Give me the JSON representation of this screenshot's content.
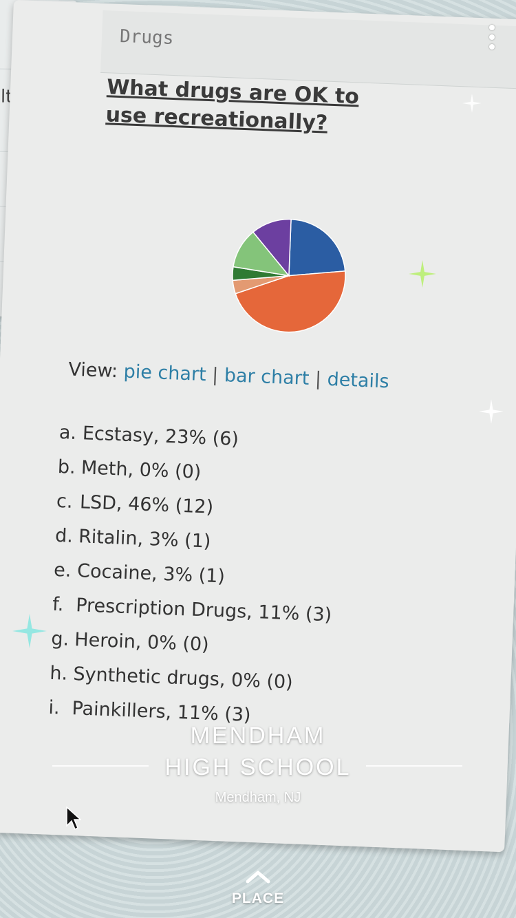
{
  "left_page": {
    "fragment": "lthy"
  },
  "page": {
    "header_label": "Drugs",
    "question": "What drugs are OK to use recreationally?",
    "view": {
      "prefix": "View:",
      "links": [
        "pie chart",
        "bar chart",
        "details"
      ],
      "separator": "|"
    },
    "answers": [
      {
        "letter": "a.",
        "text": "Ecstasy, 23% (6)"
      },
      {
        "letter": "b.",
        "text": "Meth, 0% (0)"
      },
      {
        "letter": "c.",
        "text": "LSD, 46% (12)"
      },
      {
        "letter": "d.",
        "text": "Ritalin, 3% (1)"
      },
      {
        "letter": "e.",
        "text": "Cocaine, 3% (1)"
      },
      {
        "letter": "f.",
        "text": "Prescription Drugs, 11% (3)"
      },
      {
        "letter": "g.",
        "text": "Heroin, 0% (0)"
      },
      {
        "letter": "h.",
        "text": "Synthetic drugs, 0% (0)"
      },
      {
        "letter": "i.",
        "text": "Painkillers, 11% (3)"
      }
    ]
  },
  "chart_data": {
    "type": "pie",
    "title": "",
    "slices": [
      {
        "label": "Ecstasy",
        "value": 6,
        "color": "#2b5da3"
      },
      {
        "label": "LSD",
        "value": 12,
        "color": "#e5673a"
      },
      {
        "label": "Ritalin",
        "value": 1,
        "color": "#e39a72"
      },
      {
        "label": "Cocaine",
        "value": 1,
        "color": "#2f7a33"
      },
      {
        "label": "Prescription Drugs",
        "value": 3,
        "color": "#84c47a"
      },
      {
        "label": "Painkillers",
        "value": 3,
        "color": "#6c3fa0"
      }
    ]
  },
  "geofilter": {
    "line1": "MENDHAM",
    "line2": "HIGH SCHOOL",
    "city": "Mendham, NJ"
  },
  "bottom": {
    "place_label": "PLACE"
  },
  "icons": {
    "menu": "more-vertical-icon",
    "place": "chevron-up-icon",
    "cursor": "mouse-pointer-icon"
  }
}
